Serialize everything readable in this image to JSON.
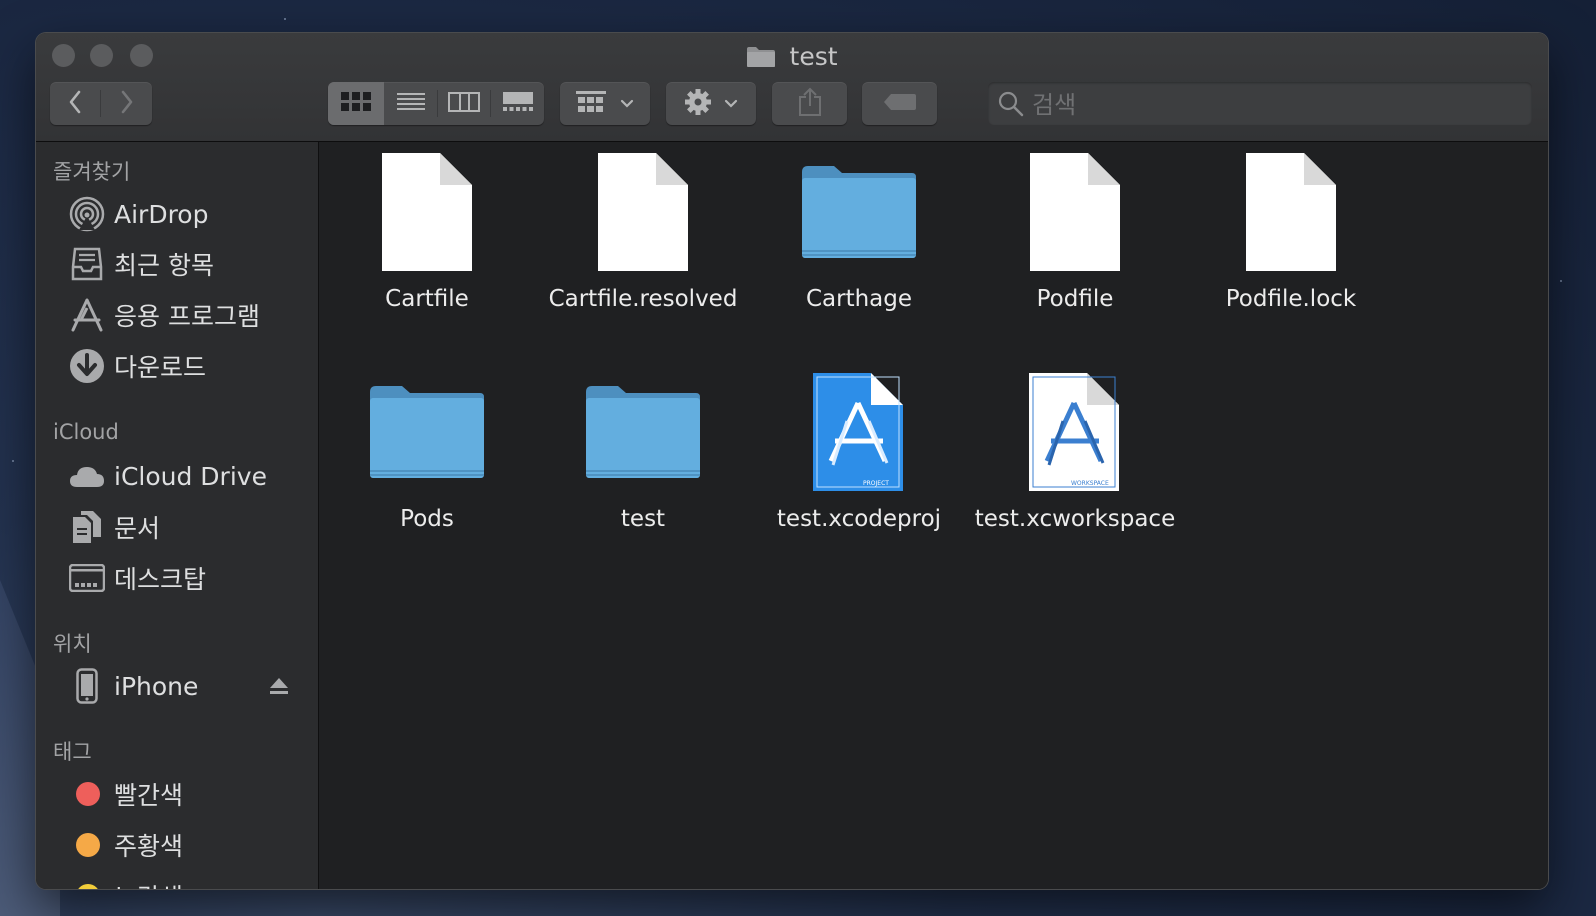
{
  "window": {
    "title": "test",
    "title_icon": "folder-icon"
  },
  "toolbar": {
    "back_icon": "chevron-left-icon",
    "forward_icon": "chevron-right-icon",
    "view_modes": [
      "icon-view-icon",
      "list-view-icon",
      "column-view-icon",
      "gallery-view-icon"
    ],
    "selected_view": "icon-view-icon",
    "group_icon": "group-by-icon",
    "action_icon": "gear-icon",
    "share_icon": "share-icon",
    "tag_icon": "tag-icon",
    "search_placeholder": "검색"
  },
  "sidebar": {
    "favorites_header": "즐겨찾기",
    "favorites": [
      {
        "label": "AirDrop",
        "icon": "airdrop-icon"
      },
      {
        "label": "최근 항목",
        "icon": "recents-icon"
      },
      {
        "label": "응용 프로그램",
        "icon": "applications-icon"
      },
      {
        "label": "다운로드",
        "icon": "downloads-icon"
      }
    ],
    "icloud_header": "iCloud",
    "icloud": [
      {
        "label": "iCloud Drive",
        "icon": "cloud-icon"
      },
      {
        "label": "문서",
        "icon": "documents-icon"
      },
      {
        "label": "데스크탑",
        "icon": "desktop-icon"
      }
    ],
    "locations_header": "위치",
    "locations": [
      {
        "label": "iPhone",
        "icon": "iphone-icon",
        "eject_icon": "eject-icon"
      }
    ],
    "tags_header": "태그",
    "tags": [
      {
        "label": "빨간색",
        "color": "#ee5f5b"
      },
      {
        "label": "주황색",
        "color": "#f5a947"
      },
      {
        "label": "노란색",
        "color": "#f2cd3a"
      }
    ]
  },
  "files": [
    {
      "name": "Cartfile",
      "kind": "document-icon"
    },
    {
      "name": "Cartfile.resolved",
      "kind": "document-icon"
    },
    {
      "name": "Carthage",
      "kind": "folder-icon"
    },
    {
      "name": "Podfile",
      "kind": "document-icon"
    },
    {
      "name": "Podfile.lock",
      "kind": "document-icon"
    },
    {
      "name": "Pods",
      "kind": "folder-icon"
    },
    {
      "name": "test",
      "kind": "folder-icon"
    },
    {
      "name": "test.xcodeproj",
      "kind": "xcodeproj-icon",
      "badge": "PROJECT"
    },
    {
      "name": "test.xcworkspace",
      "kind": "xcworkspace-icon",
      "badge": "WORKSPACE"
    }
  ],
  "colors": {
    "folder": "#5ea6d6",
    "sidebar_bg": "#2b2c2e",
    "content_bg": "#1f2022"
  }
}
